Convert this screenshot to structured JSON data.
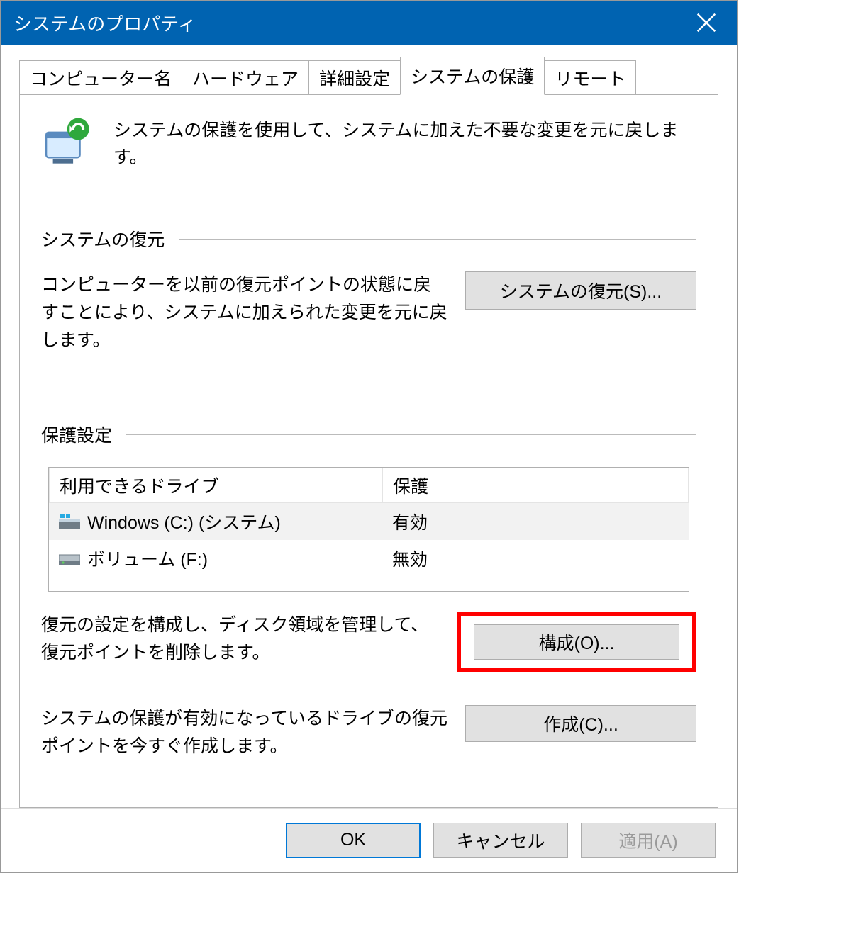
{
  "window": {
    "title": "システムのプロパティ"
  },
  "tabs": {
    "items": [
      {
        "label": "コンピューター名"
      },
      {
        "label": "ハードウェア"
      },
      {
        "label": "詳細設定"
      },
      {
        "label": "システムの保護"
      },
      {
        "label": "リモート"
      }
    ],
    "active_index": 3
  },
  "intro": {
    "text": "システムの保護を使用して、システムに加えた不要な変更を元に戻します。"
  },
  "restore": {
    "section_title": "システムの復元",
    "desc": "コンピューターを以前の復元ポイントの状態に戻すことにより、システムに加えられた変更を元に戻します。",
    "button": "システムの復元(S)..."
  },
  "protection": {
    "section_title": "保護設定",
    "columns": {
      "name": "利用できるドライブ",
      "status": "保護"
    },
    "drives": [
      {
        "name": "Windows (C:) (システム)",
        "status": "有効",
        "icon": "windows"
      },
      {
        "name": "ボリューム (F:)",
        "status": "無効",
        "icon": "hdd"
      }
    ],
    "configure_desc": "復元の設定を構成し、ディスク領域を管理して、復元ポイントを削除します。",
    "configure_button": "構成(O)...",
    "create_desc": "システムの保護が有効になっているドライブの復元ポイントを今すぐ作成します。",
    "create_button": "作成(C)..."
  },
  "footer": {
    "ok": "OK",
    "cancel": "キャンセル",
    "apply": "適用(A)"
  }
}
